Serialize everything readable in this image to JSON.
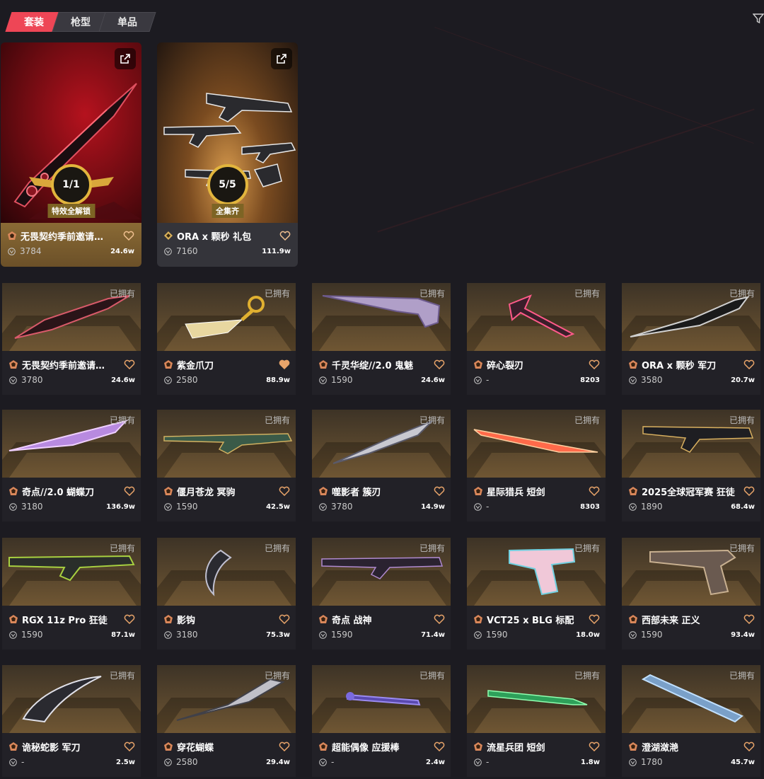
{
  "tabs": [
    {
      "label": "套装",
      "active": true
    },
    {
      "label": "枪型",
      "active": false
    },
    {
      "label": "单品",
      "active": false
    }
  ],
  "bundles": [
    {
      "name": "无畏契约季前邀请…",
      "price": "3784",
      "popularity": "24.6w",
      "progress": "1/1",
      "badge": "特效全解锁",
      "style": "gold",
      "tier": "premium"
    },
    {
      "name": "ORA x 颗秒 礼包",
      "price": "7160",
      "popularity": "111.9w",
      "progress": "5/5",
      "badge": "全集齐",
      "style": "grey",
      "tier": "exclusive"
    }
  ],
  "owned_label": "已拥有",
  "items": [
    {
      "name": "无畏契约季前邀请…",
      "price": "3780",
      "popularity": "24.6w",
      "favorited": false
    },
    {
      "name": "紫金爪刀",
      "price": "2580",
      "popularity": "88.9w",
      "favorited": true
    },
    {
      "name": "千灵华绽//2.0 鬼魅",
      "price": "1590",
      "popularity": "24.6w",
      "favorited": false
    },
    {
      "name": "碎心裂刃",
      "price": "-",
      "popularity": "8203",
      "favorited": false
    },
    {
      "name": "ORA x 颗秒 军刀",
      "price": "3580",
      "popularity": "20.7w",
      "favorited": false
    },
    {
      "name": "奇点//2.0 蝴蝶刀",
      "price": "3180",
      "popularity": "136.9w",
      "favorited": false
    },
    {
      "name": "偃月苍龙 冥驹",
      "price": "1590",
      "popularity": "42.5w",
      "favorited": false
    },
    {
      "name": "噬影者 簇刃",
      "price": "3780",
      "popularity": "14.9w",
      "favorited": false
    },
    {
      "name": "星际猎兵 短剑",
      "price": "-",
      "popularity": "8303",
      "favorited": false
    },
    {
      "name": "2025全球冠军赛 狂徒",
      "price": "1890",
      "popularity": "68.4w",
      "favorited": false
    },
    {
      "name": "RGX 11z Pro 狂徒",
      "price": "1590",
      "popularity": "87.1w",
      "favorited": false
    },
    {
      "name": "影钩",
      "price": "3180",
      "popularity": "75.3w",
      "favorited": false
    },
    {
      "name": "奇点 战神",
      "price": "1590",
      "popularity": "71.4w",
      "favorited": false
    },
    {
      "name": "VCT25 x BLG 标配",
      "price": "1590",
      "popularity": "18.0w",
      "favorited": false
    },
    {
      "name": "西部未来 正义",
      "price": "1590",
      "popularity": "93.4w",
      "favorited": false
    },
    {
      "name": "诡秘蛇影 军刀",
      "price": "-",
      "popularity": "2.5w",
      "favorited": false
    },
    {
      "name": "穿花蝴蝶",
      "price": "2580",
      "popularity": "29.4w",
      "favorited": false
    },
    {
      "name": "超能偶像 应援棒",
      "price": "-",
      "popularity": "2.4w",
      "favorited": false
    },
    {
      "name": "流星兵团 短剑",
      "price": "-",
      "popularity": "1.8w",
      "favorited": false
    },
    {
      "name": "澄湖潋滟",
      "price": "1780",
      "popularity": "45.7w",
      "favorited": false
    }
  ],
  "colors": {
    "accent": "#ee4656",
    "heart": "#e8a46a",
    "tier_icon": "#d9875a",
    "gold_badge": "#e2b53d"
  }
}
